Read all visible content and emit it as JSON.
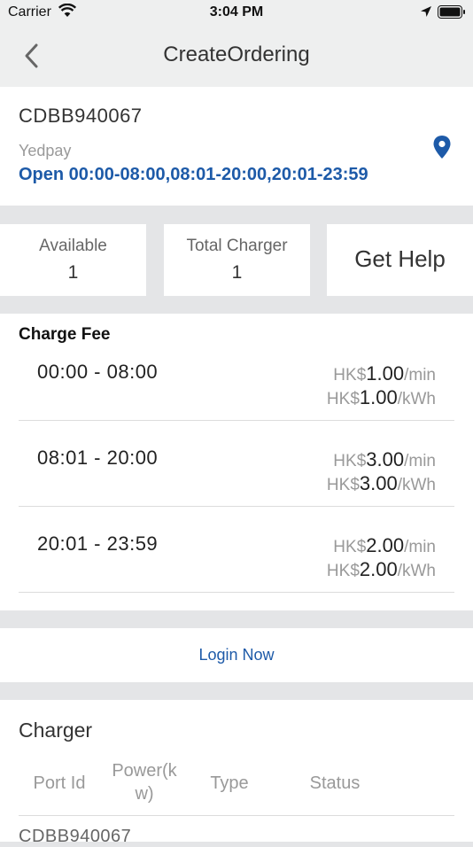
{
  "status_bar": {
    "carrier": "Carrier",
    "time": "3:04 PM"
  },
  "nav": {
    "title": "CreateOrdering"
  },
  "station": {
    "code": "CDBB940067",
    "operator": "Yedpay",
    "hours": "Open 00:00-08:00,08:01-20:00,20:01-23:59"
  },
  "stats": {
    "available_label": "Available",
    "available_value": "1",
    "total_label": "Total Charger",
    "total_value": "1",
    "help_label": "Get Help"
  },
  "fees": {
    "heading": "Charge Fee",
    "rows": [
      {
        "range": "00:00 - 08:00",
        "currency": "HK$",
        "per_min": "1.00",
        "per_kwh": "1.00",
        "unit_min": "/min",
        "unit_kwh": "/kWh"
      },
      {
        "range": "08:01 - 20:00",
        "currency": "HK$",
        "per_min": "3.00",
        "per_kwh": "3.00",
        "unit_min": "/min",
        "unit_kwh": "/kWh"
      },
      {
        "range": "20:01 - 23:59",
        "currency": "HK$",
        "per_min": "2.00",
        "per_kwh": "2.00",
        "unit_min": "/min",
        "unit_kwh": "/kWh"
      }
    ]
  },
  "login": {
    "label": "Login Now"
  },
  "charger": {
    "heading": "Charger",
    "columns": {
      "port_id": "Port Id",
      "power_line1": "Power(k",
      "power_line2": "w)",
      "type": "Type",
      "status": "Status"
    },
    "rows": [
      {
        "port_id": "CDBB940067"
      }
    ]
  },
  "colors": {
    "accent": "#1d5aa8",
    "background": "#e4e5e7",
    "nav_bg": "#eeefef"
  },
  "icons": [
    "wifi-icon",
    "location-arrow-icon",
    "battery-icon",
    "back-chevron-icon",
    "map-pin-icon"
  ]
}
